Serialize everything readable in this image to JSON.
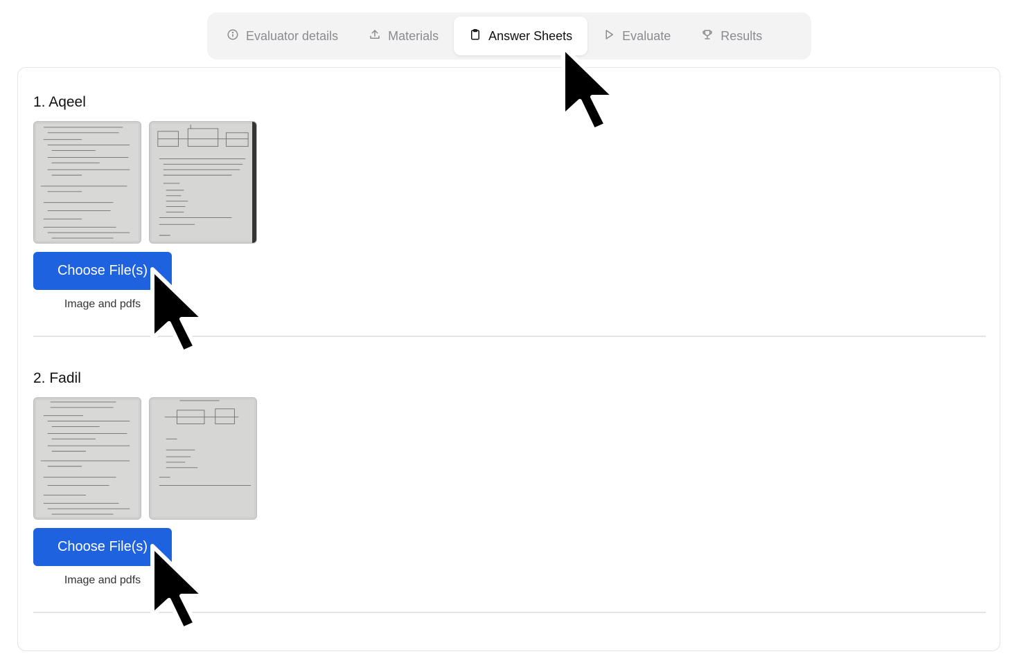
{
  "tabs": [
    {
      "label": "Evaluator details",
      "icon": "info-icon"
    },
    {
      "label": "Materials",
      "icon": "upload-icon"
    },
    {
      "label": "Answer Sheets",
      "icon": "clipboard-icon",
      "active": true
    },
    {
      "label": "Evaluate",
      "icon": "play-icon"
    },
    {
      "label": "Results",
      "icon": "trophy-icon"
    }
  ],
  "students": [
    {
      "title": "1. Aqeel",
      "button_label": "Choose File(s)",
      "hint": "Image and pdfs"
    },
    {
      "title": "2. Fadil",
      "button_label": "Choose File(s)",
      "hint": "Image and pdfs"
    }
  ],
  "colors": {
    "accent": "#1f62e0",
    "tab_bg": "#f3f3f4",
    "border": "#e4e4e7"
  }
}
